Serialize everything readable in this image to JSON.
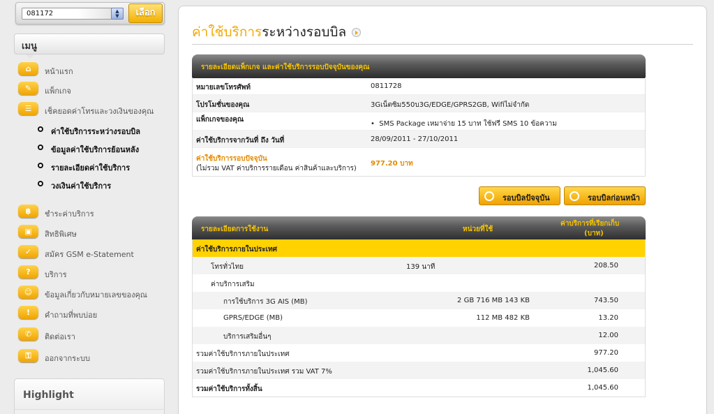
{
  "number_selector": {
    "value": "081172",
    "button_label": "เลือก"
  },
  "menu": {
    "header": "เมนู",
    "items": [
      {
        "label": "หน้าแรก",
        "icon": "home-icon"
      },
      {
        "label": "แพ็กเกจ",
        "icon": "package-icon"
      },
      {
        "label": "เช็คยอดค่าโทรและวงเงินของคุณ",
        "icon": "bill-check-icon"
      },
      {
        "label": "ชำระค่าบริการ",
        "icon": "payment-icon"
      },
      {
        "label": "สิทธิพิเศษ",
        "icon": "gift-icon"
      },
      {
        "label": "สมัคร GSM e-Statement",
        "icon": "estatement-icon"
      },
      {
        "label": "บริการ",
        "icon": "service-icon"
      },
      {
        "label": "ข้อมูลเกี่ยวกับหมายเลขของคุณ",
        "icon": "user-info-icon"
      },
      {
        "label": "คำถามที่พบบ่อย",
        "icon": "faq-icon"
      },
      {
        "label": "ติดต่อเรา",
        "icon": "phone-icon"
      },
      {
        "label": "ออกจากระบบ",
        "icon": "logout-icon"
      }
    ],
    "subitems": [
      {
        "label": "ค่าใช้บริการระหว่างรอบบิล"
      },
      {
        "label": "ข้อมูลค่าใช้บริการย้อนหลัง"
      },
      {
        "label": "รายละเอียดค่าใช้บริการ"
      },
      {
        "label": "วงเงินค่าใช้บริการ"
      }
    ]
  },
  "highlight": {
    "title": "Highlight"
  },
  "page_title": {
    "part1": "ค่าใช้บริการ",
    "part2": "ระหว่างรอบบิล"
  },
  "package_section": {
    "header": "รายละเอียดแพ็กเกจ และค่าใช้บริการรอบปัจจุบันของคุณ",
    "phone_label": "หมายเลขโทรศัพท์",
    "phone_value": "0811728",
    "promo_label": "โปรโมชั่นของคุณ",
    "promo_value": "3Gเน็ตซิม550บ3G/EDGE/GPRS2GB, Wifiไม่จำกัด",
    "pkg_label": "แพ็กเกจของคุณ",
    "pkg_value": "SMS Package เหมาจ่าย 15 บาท ใช้ฟรี SMS 10 ข้อความ",
    "period_label": "ค่าใช้บริการจากวันที่ ถึง วันที่",
    "period_value": "28/09/2011 - 27/10/2011",
    "current_label": "ค่าใช้บริการรอบปัจจุบัน",
    "current_note": "(ไม่รวม VAT ค่าบริการรายเดือน ค่าสินค้าและบริการ)",
    "current_value": "977.20 บาท"
  },
  "buttons": {
    "current_bill": "รอบบิลปัจจุบัน",
    "previous_bill": "รอบบิลก่อนหน้า"
  },
  "usage_section": {
    "header_desc": "รายละเอียดการใช้งาน",
    "header_units": "หน่วยที่ใช้",
    "header_charge_line1": "ค่าบริการที่เรียกเก็บ",
    "header_charge_line2": "(บาท)",
    "rows": [
      {
        "desc": "ค่าใช้บริการภายในประเทศ",
        "units": "",
        "charge": ""
      },
      {
        "desc": "โทรทั่วไทย",
        "units": "139 นาที",
        "charge": "208.50"
      },
      {
        "desc": "ค่าบริการเสริม",
        "units": "",
        "charge": ""
      },
      {
        "desc": "การใช้บริการ 3G AIS (MB)",
        "units": "2 GB 716 MB 143 KB",
        "charge": "743.50"
      },
      {
        "desc": "GPRS/EDGE (MB)",
        "units": "112 MB 482 KB",
        "charge": "13.20"
      },
      {
        "desc": "บริการเสริมอื่นๆ",
        "units": "",
        "charge": "12.00"
      },
      {
        "desc": "รวมค่าใช้บริการภายในประเทศ",
        "units": "",
        "charge": "977.20"
      },
      {
        "desc": "รวมค่าใช้บริการภายในประเทศ รวม VAT 7%",
        "units": "",
        "charge": "1,045.60"
      },
      {
        "desc": "รวมค่าใช้บริการทั้งสิ้น",
        "units": "",
        "charge": "1,045.60"
      }
    ]
  },
  "colors": {
    "accent": "#f2a900",
    "highlight_row": "#ffd200",
    "header_text": "#f5c300"
  }
}
